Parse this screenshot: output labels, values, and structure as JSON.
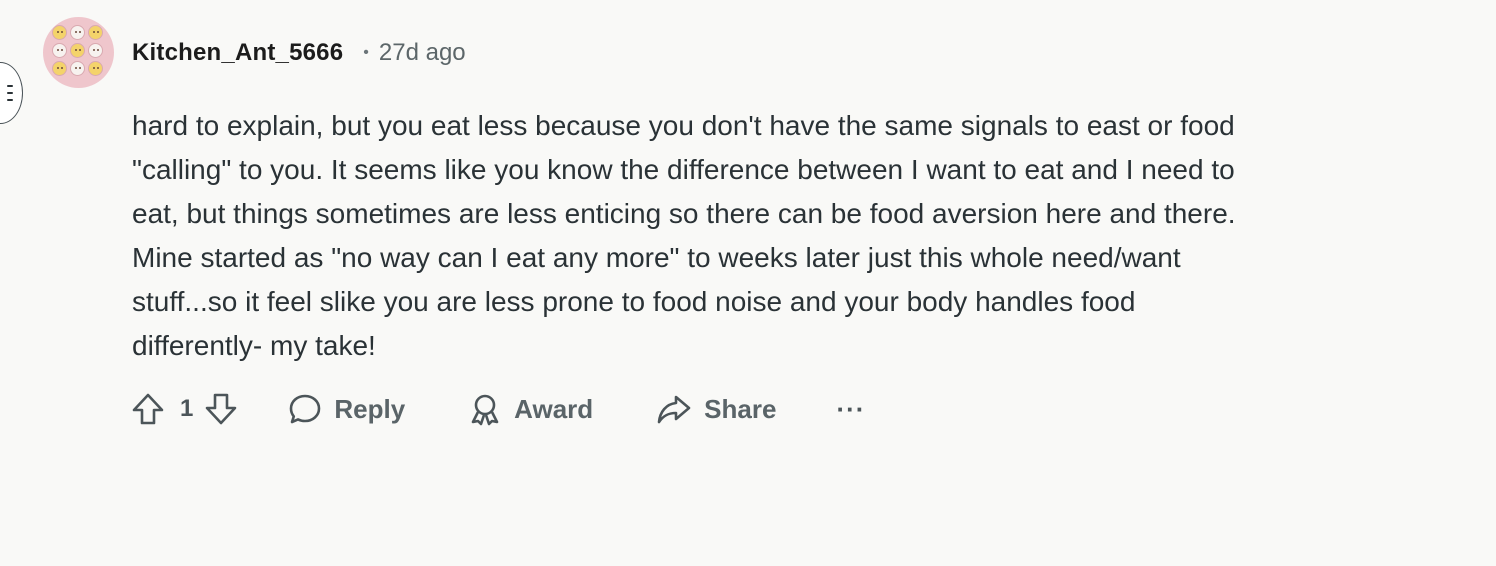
{
  "comment": {
    "username": "Kitchen_Ant_5666",
    "separator": "•",
    "timestamp": "27d ago",
    "body_lines": [
      "hard to explain, but you eat less because you don't have the same signals to east or food",
      "\"calling\" to you. It seems like you know the difference between I want to eat and I need to",
      "eat, but things sometimes are less enticing so there can be food aversion here and there.",
      "Mine started as \"no way can I eat any more\" to weeks later just this whole need/want",
      "stuff...so it feel slike you are less prone to food noise and your body handles food",
      "differently- my take!"
    ],
    "vote_count": "1",
    "actions": {
      "reply_label": "Reply",
      "award_label": "Award",
      "share_label": "Share",
      "more_label": "···"
    }
  },
  "icons": {
    "upvote": "arrow-up-icon",
    "downvote": "arrow-down-icon",
    "reply": "speech-bubble-icon",
    "award": "award-ribbon-icon",
    "share": "share-arrow-icon",
    "collapse": "collapse-thread-icon"
  },
  "colors": {
    "background": "#f9f9f7",
    "text": "#2a3236",
    "muted": "#5a6468",
    "avatar_bg": "#efc6cc"
  }
}
